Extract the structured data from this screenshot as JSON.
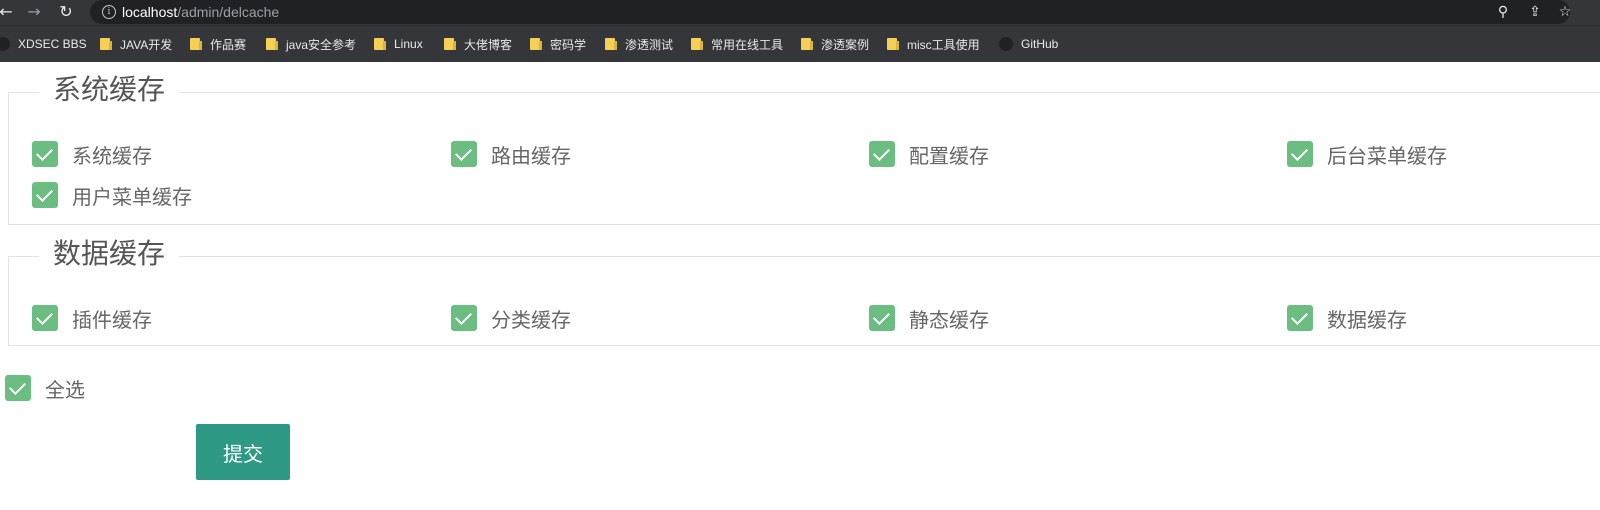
{
  "browser": {
    "url_host": "localhost",
    "url_path": "/admin/delcache",
    "bookmarks": [
      {
        "label": "XDSEC BBS",
        "icon": "site-icon"
      },
      {
        "label": "JAVA开发",
        "icon": "folder-icon"
      },
      {
        "label": "作品赛",
        "icon": "folder-icon"
      },
      {
        "label": "java安全参考",
        "icon": "folder-icon"
      },
      {
        "label": "Linux",
        "icon": "folder-icon"
      },
      {
        "label": "大佬博客",
        "icon": "folder-icon"
      },
      {
        "label": "密码学",
        "icon": "folder-icon"
      },
      {
        "label": "渗透测试",
        "icon": "folder-icon"
      },
      {
        "label": "常用在线工具",
        "icon": "folder-icon"
      },
      {
        "label": "渗透案例",
        "icon": "folder-icon"
      },
      {
        "label": "misc工具使用",
        "icon": "folder-icon"
      },
      {
        "label": "GitHub",
        "icon": "github-icon"
      }
    ]
  },
  "system_cache": {
    "title": "系统缓存",
    "items": [
      {
        "label": "系统缓存",
        "checked": true
      },
      {
        "label": "路由缓存",
        "checked": true
      },
      {
        "label": "配置缓存",
        "checked": true
      },
      {
        "label": "后台菜单缓存",
        "checked": true
      },
      {
        "label": "用户菜单缓存",
        "checked": true
      }
    ]
  },
  "data_cache": {
    "title": "数据缓存",
    "items": [
      {
        "label": "插件缓存",
        "checked": true
      },
      {
        "label": "分类缓存",
        "checked": true
      },
      {
        "label": "静态缓存",
        "checked": true
      },
      {
        "label": "数据缓存",
        "checked": true
      }
    ]
  },
  "select_all": {
    "label": "全选",
    "checked": true
  },
  "submit_label": "提交",
  "colors": {
    "checkbox": "#6cbd82",
    "submit": "#2e9a86",
    "chrome": "#35363a"
  }
}
